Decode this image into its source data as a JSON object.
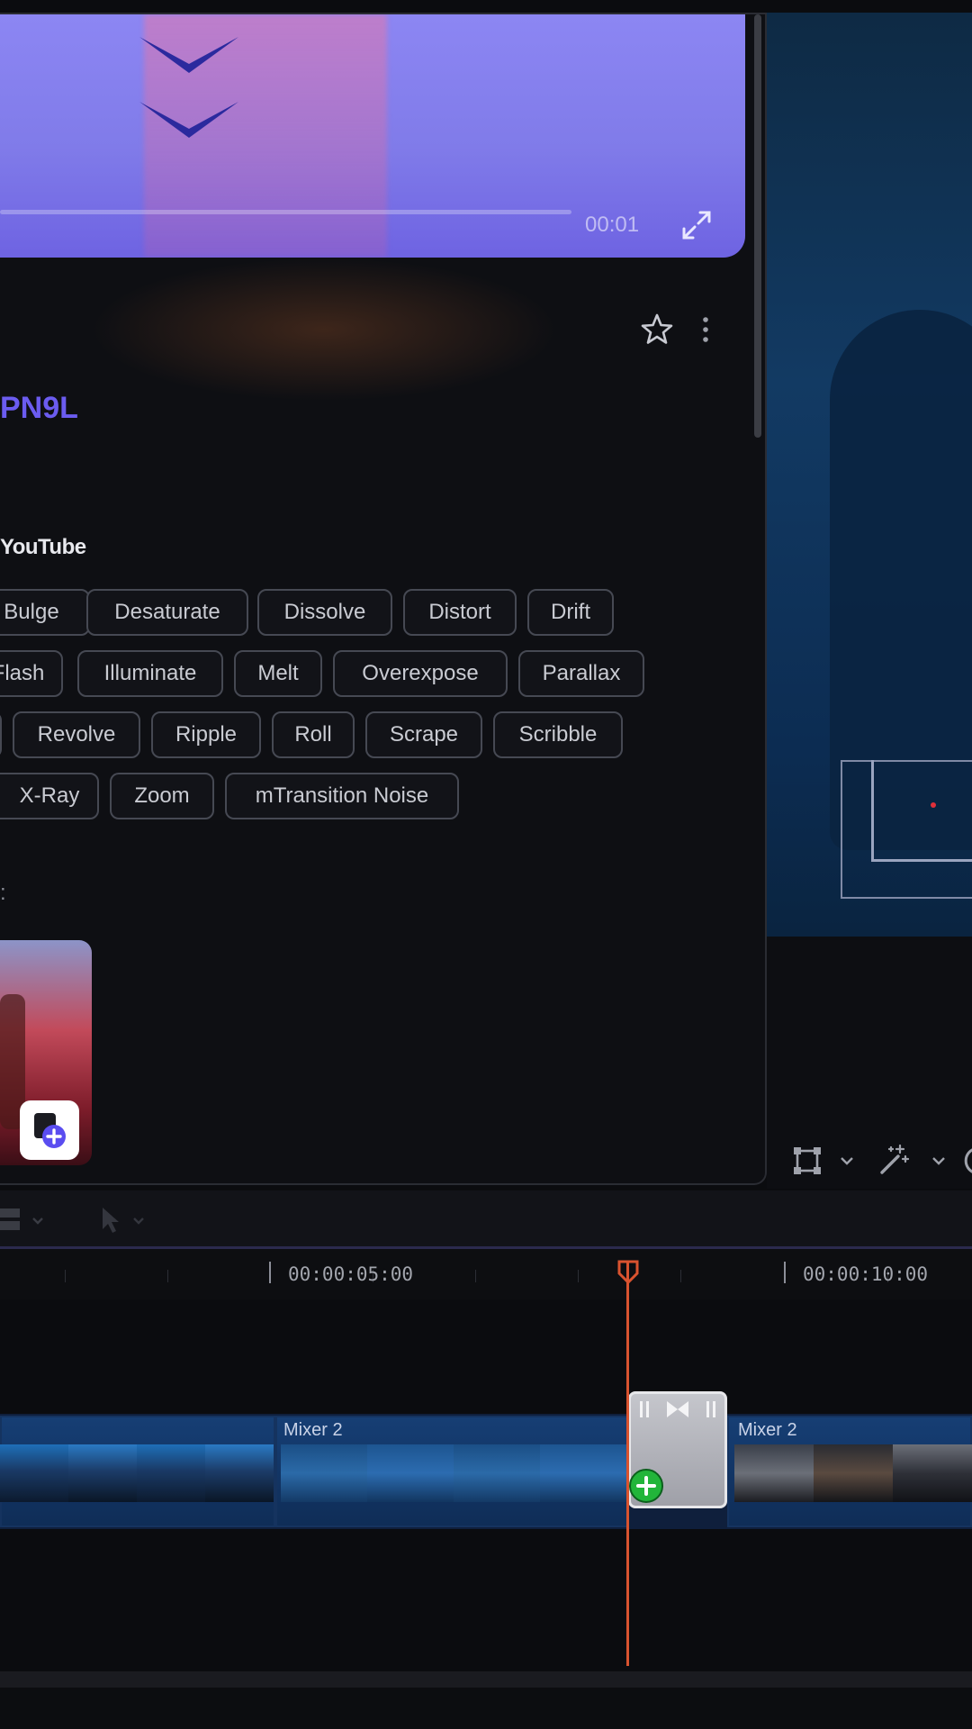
{
  "preview": {
    "time": "00:01",
    "progress_fraction": 0.98
  },
  "pack": {
    "title": "PN9L",
    "category": "YouTube",
    "section_mark": ":"
  },
  "tags": [
    {
      "label": "Bulge"
    },
    {
      "label": "Desaturate"
    },
    {
      "label": "Dissolve"
    },
    {
      "label": "Distort"
    },
    {
      "label": "Drift"
    },
    {
      "label": "Flash"
    },
    {
      "label": "Illuminate"
    },
    {
      "label": "Melt"
    },
    {
      "label": "Overexpose"
    },
    {
      "label": "Parallax"
    },
    {
      "label": ""
    },
    {
      "label": "Revolve"
    },
    {
      "label": "Ripple"
    },
    {
      "label": "Roll"
    },
    {
      "label": "Scrape"
    },
    {
      "label": "Scribble"
    },
    {
      "label": "X-Ray"
    },
    {
      "label": "Zoom"
    },
    {
      "label": "mTransition Noise"
    }
  ],
  "timeline": {
    "timecodes": [
      "00:00:05:00",
      "00:00:10:00"
    ],
    "clips": [
      {
        "label": ""
      },
      {
        "label": "Mixer 2"
      },
      {
        "label": "Mixer 2"
      }
    ]
  },
  "colors": {
    "accent": "#6b5cf0",
    "playhead": "#d9532f",
    "clip": "#163e74",
    "add_badge": "#22b53a"
  },
  "icons": [
    "chevron-down-icon",
    "expand-icon",
    "star-icon",
    "more-vertical-icon",
    "add-to-project-icon",
    "transform-icon",
    "magic-wand-icon",
    "layout-icon",
    "pointer-icon",
    "plus-icon",
    "transition-icon"
  ]
}
